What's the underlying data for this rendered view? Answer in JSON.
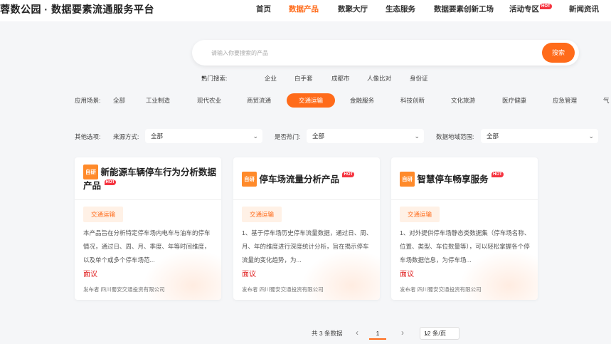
{
  "brand": "蓉数公园 · 数据要素流通服务平台",
  "nav": [
    {
      "label": "首页"
    },
    {
      "label": "数据产品"
    },
    {
      "label": "数聚大厅"
    },
    {
      "label": "生态服务"
    },
    {
      "label": "数据要素创新工场"
    },
    {
      "label": "活动专区",
      "badge": "HOT"
    },
    {
      "label": "新闻资讯"
    }
  ],
  "search": {
    "placeholder": "请输入你要搜索的产品",
    "button": "搜索"
  },
  "hot": {
    "label": "热门搜索:",
    "terms": [
      "企业",
      "白手套",
      "成都市",
      "人像比对",
      "身份证"
    ]
  },
  "scenes": {
    "label": "应用场景:",
    "items": [
      "全部",
      "工业制造",
      "现代农业",
      "商贸流通",
      "交通运输",
      "金融服务",
      "科技创新",
      "文化旅游",
      "医疗健康",
      "应急管理",
      "气"
    ],
    "active": "交通运输"
  },
  "filters": {
    "label": "其他选项:",
    "source_label": "来源方式:",
    "source_value": "全部",
    "hot_label": "是否热门:",
    "hot_value": "全部",
    "region_label": "数据地域范围:",
    "region_value": "全部"
  },
  "cards": [
    {
      "tag": "自研",
      "title": "新能源车辆停车行为分析数据产品",
      "hot": "HOT",
      "category": "交通运输",
      "desc": "本产品旨在分析特定停车场内电车与油车的停车情况，通过日、周、月、季度、年等时间维度，以及单个或多个停车场范...",
      "price": "面议",
      "publisher": "发布者  四川蜀安交通投资有限公司"
    },
    {
      "tag": "自研",
      "title": "停车场流量分析产品",
      "hot": "HOT",
      "category": "交通运输",
      "desc": "1、基于停车场历史停车流量数据，通过日、周、月、年的维度进行深度统计分析，旨在揭示停车流量的变化趋势，为...",
      "price": "面议",
      "publisher": "发布者  四川蜀安交通投资有限公司"
    },
    {
      "tag": "自研",
      "title": "智慧停车畅享服务",
      "hot": "HOT",
      "category": "交通运输",
      "desc": "1、对外提供停车场静态类数据集（停车场名称、位置、类型、车位数量等），可以轻松掌握各个停车场数据信息，为停车场...",
      "price": "面议",
      "publisher": "发布者  四川蜀安交通投资有限公司"
    }
  ],
  "pagination": {
    "total": "共 3 条数据",
    "prev": "‹",
    "page": "1",
    "next": "›",
    "size": "12 条/页"
  },
  "colors": {
    "accent": "#ff6b1a",
    "hot": "#f5333f",
    "price": "#e02020"
  }
}
